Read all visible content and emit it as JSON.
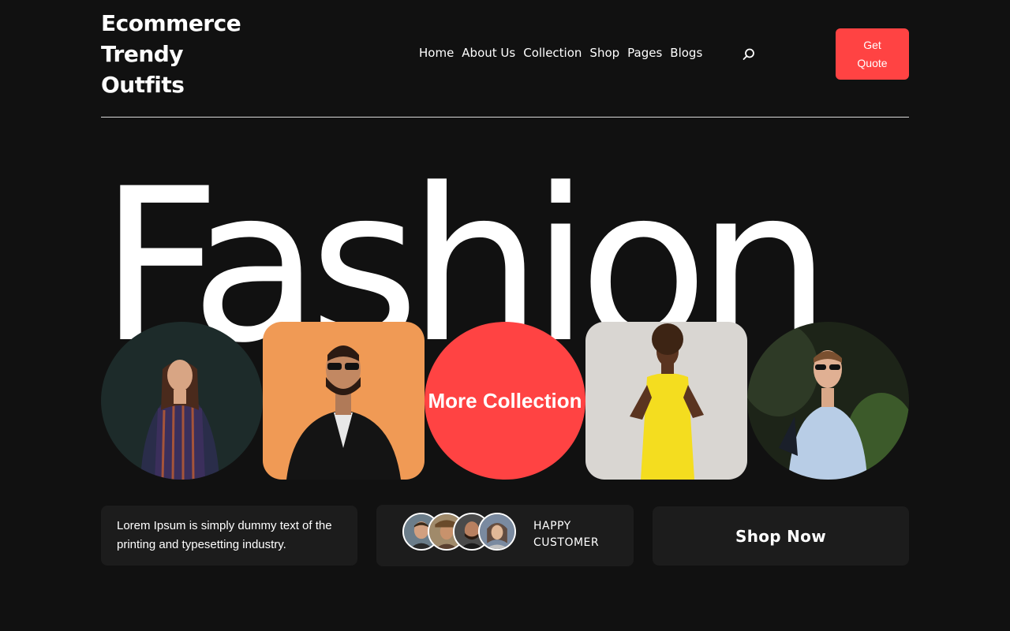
{
  "header": {
    "brand": "Ecommerce Trendy Outfits",
    "nav": [
      "Home",
      "About Us",
      "Collection",
      "Shop",
      "Pages",
      "Blogs"
    ],
    "search_icon": "search-icon",
    "quote_button": "Get Quote"
  },
  "hero": {
    "headline": "Fashion"
  },
  "gallery": {
    "more_collection": "More Collection"
  },
  "cards": {
    "description": "Lorem Ipsum is simply dummy text of the printing and typesetting industry.",
    "customers_label": "HAPPY CUSTOMER",
    "shop_button": "Shop Now"
  },
  "colors": {
    "background": "#111111",
    "accent": "#ff4343",
    "card": "#1c1c1c",
    "text": "#ffffff"
  }
}
